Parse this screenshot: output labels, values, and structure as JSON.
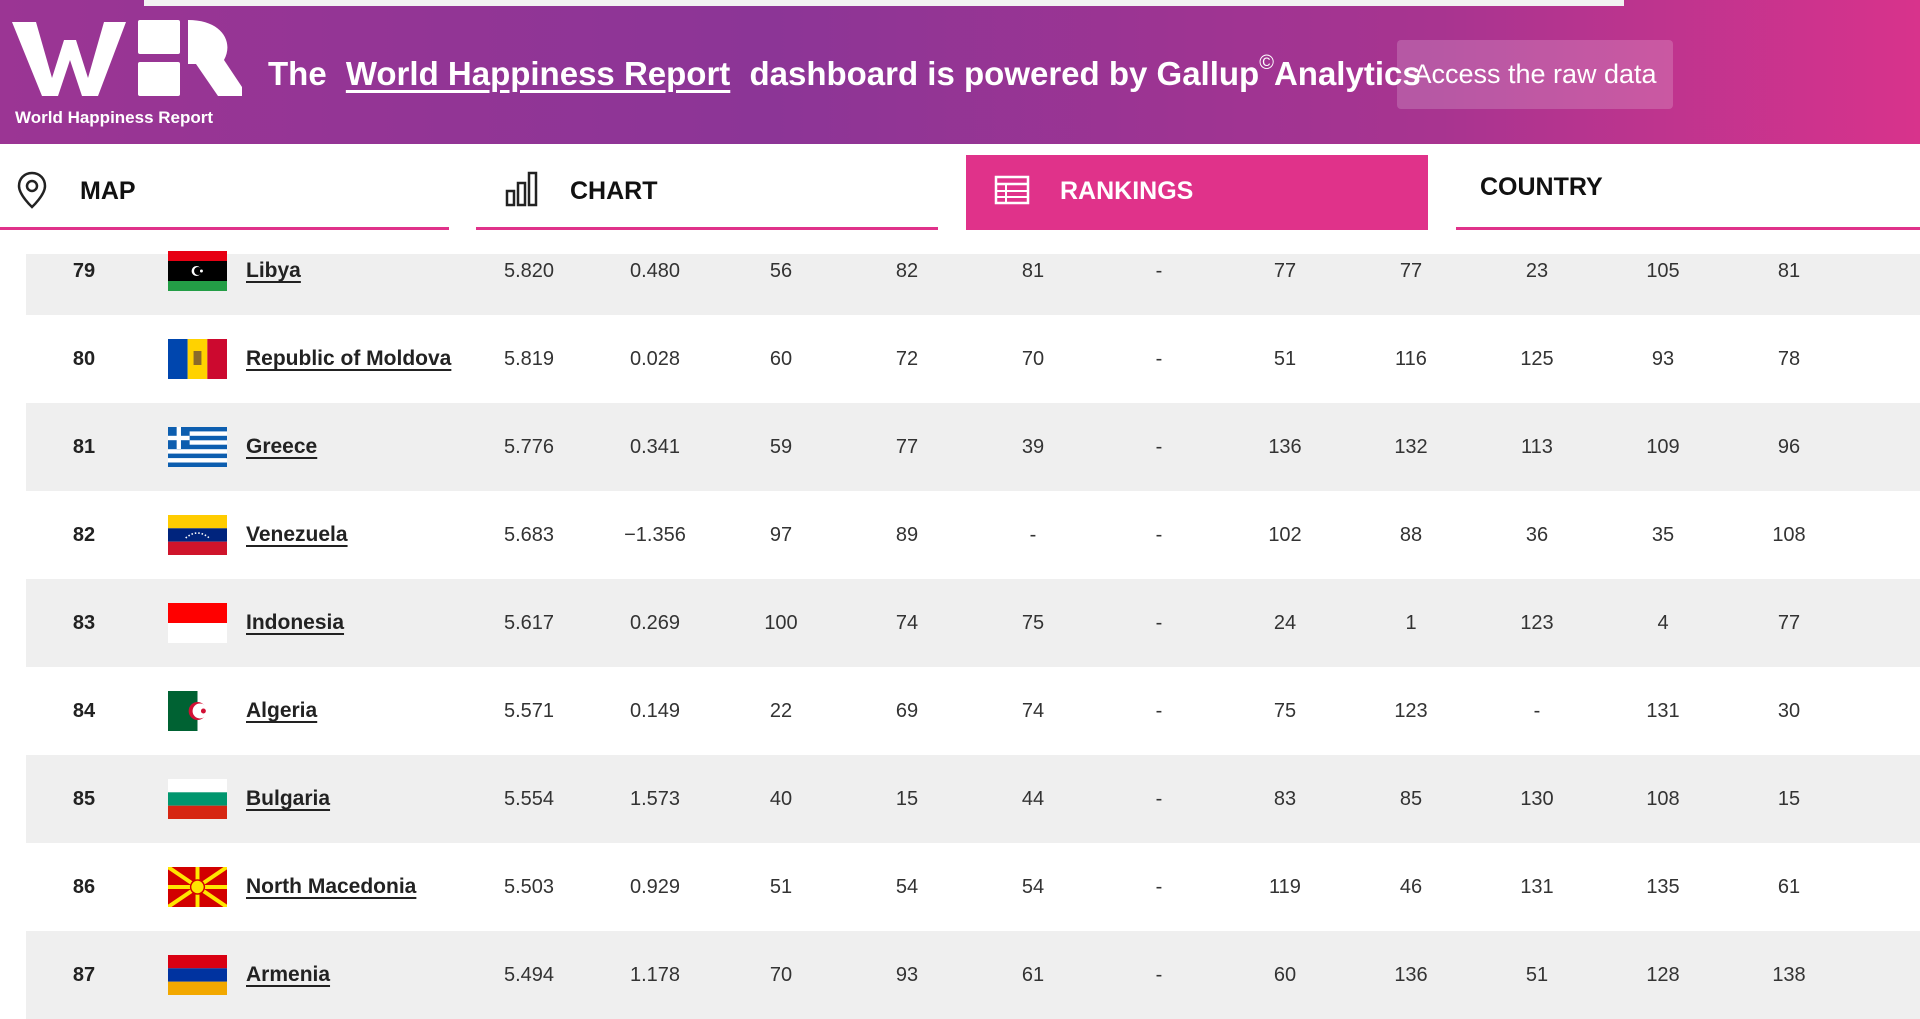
{
  "header": {
    "logo_text": "World Happiness Report",
    "headline_prefix": "The",
    "headline_link": "World Happiness Report",
    "headline_suffix": "dashboard is powered by Gallup",
    "headline_copyright": "©",
    "headline_end": "Analytics",
    "raw_data_button": "Access the raw data"
  },
  "tabs": [
    {
      "label": "MAP",
      "icon": "map-pin-icon",
      "active": false
    },
    {
      "label": "CHART",
      "icon": "bar-chart-icon",
      "active": false
    },
    {
      "label": "RANKINGS",
      "icon": "table-icon",
      "active": true
    },
    {
      "label": "COUNTRY",
      "icon": "",
      "active": false
    }
  ],
  "colors": {
    "accent": "#e0328a",
    "header_start": "#9b3594",
    "header_end": "#d8338c",
    "row_shade": "#efefef"
  },
  "rows": [
    {
      "rank": "79",
      "country": "Libya",
      "flag": "libya",
      "values": [
        "5.820",
        "0.480",
        "56",
        "82",
        "81",
        "-",
        "77",
        "77",
        "23",
        "105",
        "81"
      ]
    },
    {
      "rank": "80",
      "country": "Republic of Moldova",
      "flag": "moldova",
      "values": [
        "5.819",
        "0.028",
        "60",
        "72",
        "70",
        "-",
        "51",
        "116",
        "125",
        "93",
        "78"
      ]
    },
    {
      "rank": "81",
      "country": "Greece",
      "flag": "greece",
      "values": [
        "5.776",
        "0.341",
        "59",
        "77",
        "39",
        "-",
        "136",
        "132",
        "113",
        "109",
        "96"
      ]
    },
    {
      "rank": "82",
      "country": "Venezuela",
      "flag": "venezuela",
      "values": [
        "5.683",
        "−1.356",
        "97",
        "89",
        "-",
        "-",
        "102",
        "88",
        "36",
        "35",
        "108"
      ]
    },
    {
      "rank": "83",
      "country": "Indonesia",
      "flag": "indonesia",
      "values": [
        "5.617",
        "0.269",
        "100",
        "74",
        "75",
        "-",
        "24",
        "1",
        "123",
        "4",
        "77"
      ]
    },
    {
      "rank": "84",
      "country": "Algeria",
      "flag": "algeria",
      "values": [
        "5.571",
        "0.149",
        "22",
        "69",
        "74",
        "-",
        "75",
        "123",
        "-",
        "131",
        "30"
      ]
    },
    {
      "rank": "85",
      "country": "Bulgaria",
      "flag": "bulgaria",
      "values": [
        "5.554",
        "1.573",
        "40",
        "15",
        "44",
        "-",
        "83",
        "85",
        "130",
        "108",
        "15"
      ]
    },
    {
      "rank": "86",
      "country": "North Macedonia",
      "flag": "north-macedonia",
      "values": [
        "5.503",
        "0.929",
        "51",
        "54",
        "54",
        "-",
        "119",
        "46",
        "131",
        "135",
        "61"
      ]
    },
    {
      "rank": "87",
      "country": "Armenia",
      "flag": "armenia",
      "values": [
        "5.494",
        "1.178",
        "70",
        "93",
        "61",
        "-",
        "60",
        "136",
        "51",
        "128",
        "138"
      ]
    }
  ]
}
